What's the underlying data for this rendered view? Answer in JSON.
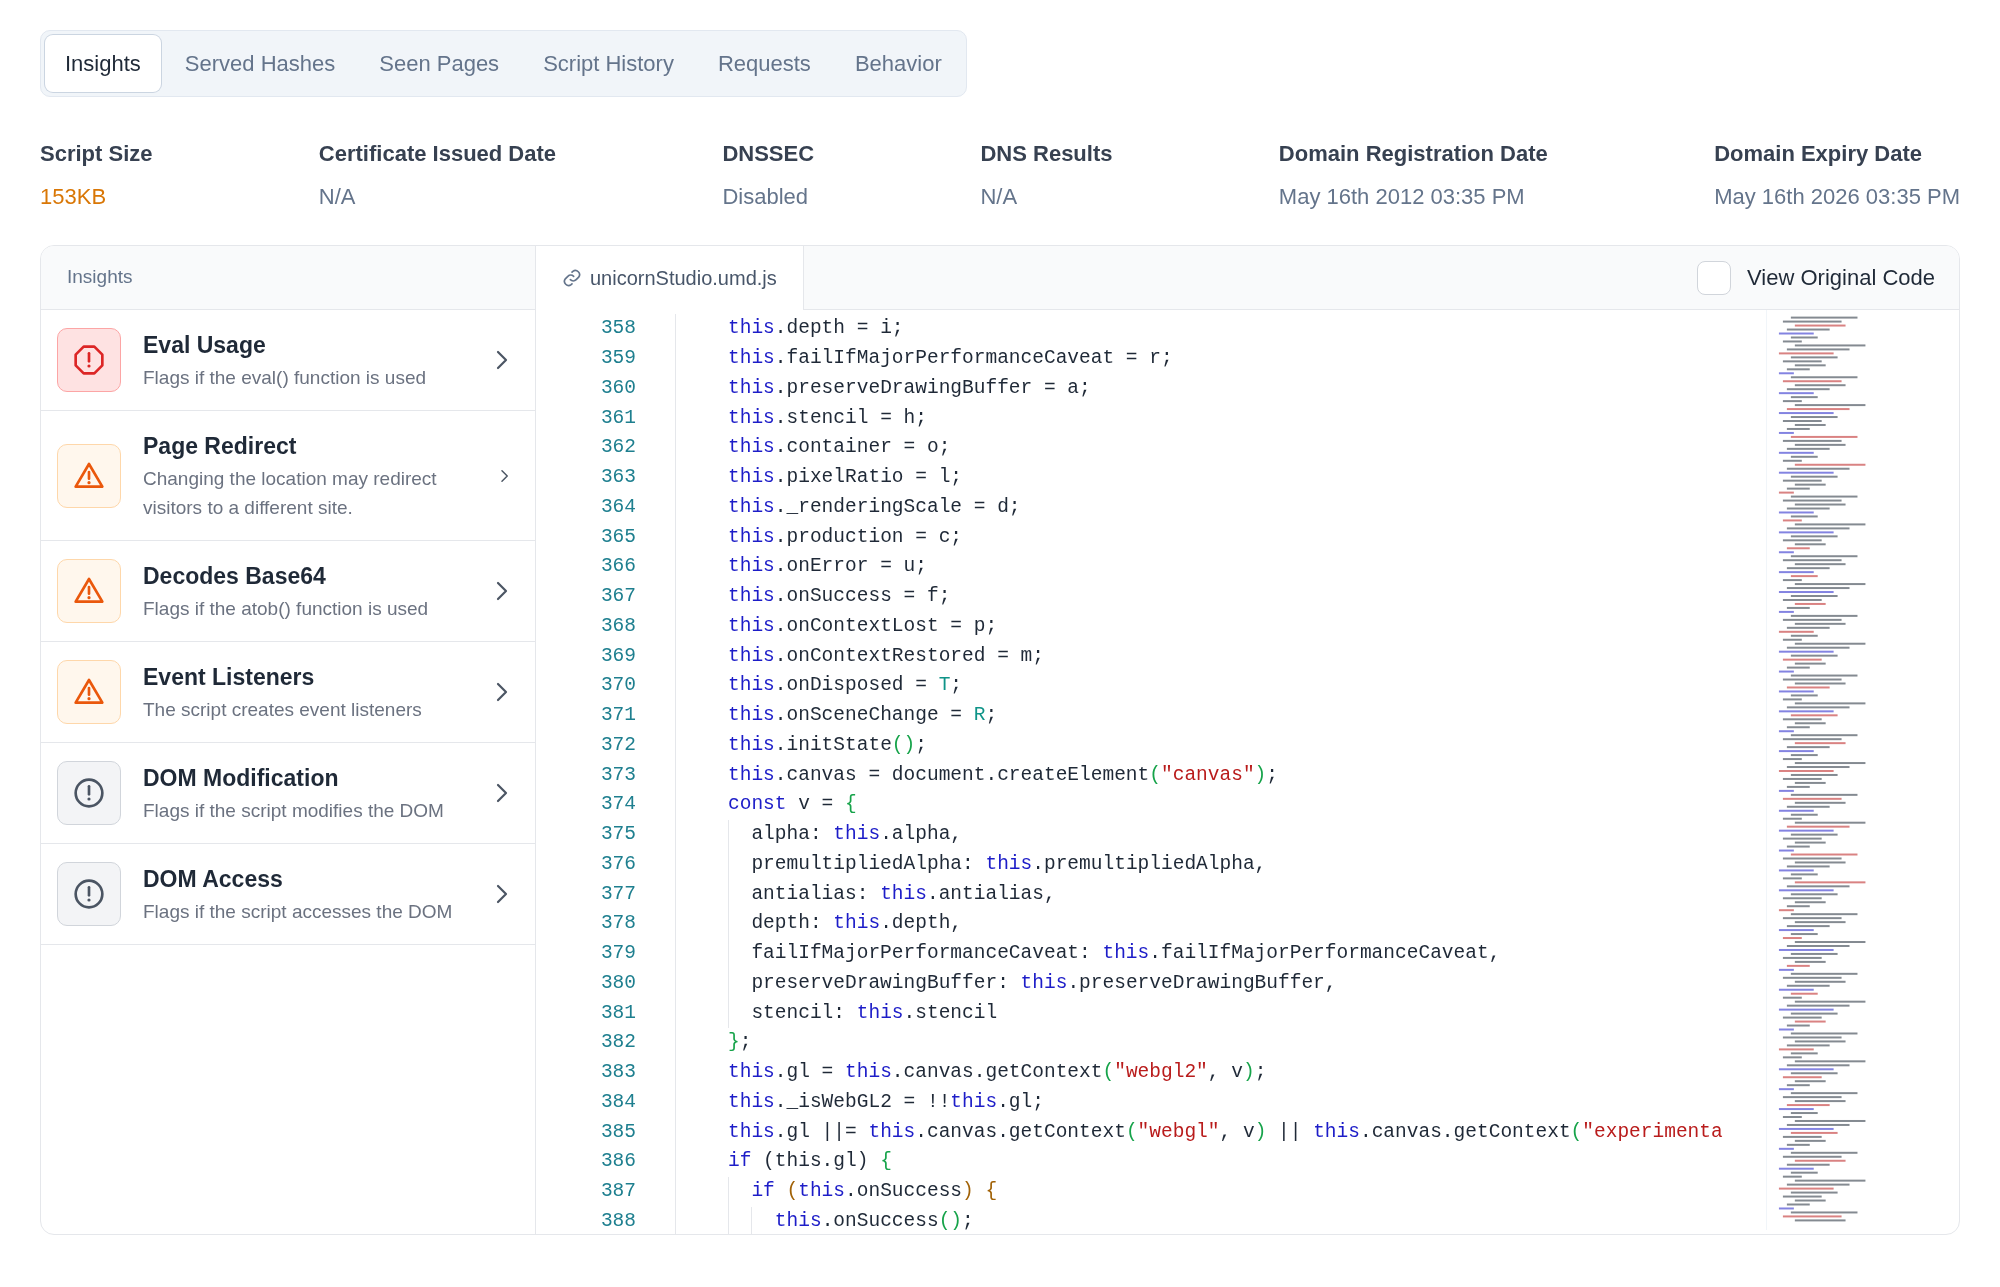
{
  "tabs": [
    {
      "label": "Insights",
      "selected": true
    },
    {
      "label": "Served Hashes",
      "selected": false
    },
    {
      "label": "Seen Pages",
      "selected": false
    },
    {
      "label": "Script History",
      "selected": false
    },
    {
      "label": "Requests",
      "selected": false
    },
    {
      "label": "Behavior",
      "selected": false
    }
  ],
  "stats": [
    {
      "label": "Script Size",
      "value": "153KB",
      "flagged": true
    },
    {
      "label": "Certificate Issued Date",
      "value": "N/A",
      "flagged": false
    },
    {
      "label": "DNSSEC",
      "value": "Disabled",
      "flagged": false
    },
    {
      "label": "DNS Results",
      "value": "N/A",
      "flagged": false
    },
    {
      "label": "Domain Registration Date",
      "value": "May 16th 2012 03:35 PM",
      "flagged": false
    },
    {
      "label": "Domain Expiry Date",
      "value": "May 16th 2026 03:35 PM",
      "flagged": false
    }
  ],
  "insights_panel": {
    "title": "Insights",
    "items": [
      {
        "title": "Eval Usage",
        "description": "Flags if the eval() function is used",
        "kind": "critical"
      },
      {
        "title": "Page Redirect",
        "description": "Changing the location may redirect visitors to a different site.",
        "kind": "warning"
      },
      {
        "title": "Decodes Base64",
        "description": "Flags if the atob() function is used",
        "kind": "warning"
      },
      {
        "title": "Event Listeners",
        "description": "The script creates event listeners",
        "kind": "warning"
      },
      {
        "title": "DOM Modification",
        "description": "Flags if the script modifies the DOM",
        "kind": "info"
      },
      {
        "title": "DOM Access",
        "description": "Flags if the script accesses the DOM",
        "kind": "info"
      }
    ]
  },
  "code_viewer": {
    "file_name": "unicornStudio.umd.js",
    "view_original": {
      "label": "View Original Code",
      "checked": false
    },
    "lines": [
      {
        "number": "358",
        "tokens": [
          {
            "kind": "kw",
            "text": "this"
          },
          {
            "kind": "plain",
            "text": ".depth = i;"
          }
        ]
      },
      {
        "number": "359",
        "tokens": [
          {
            "kind": "kw",
            "text": "this"
          },
          {
            "kind": "plain",
            "text": ".failIfMajorPerformanceCaveat = r;"
          }
        ]
      },
      {
        "number": "360",
        "tokens": [
          {
            "kind": "kw",
            "text": "this"
          },
          {
            "kind": "plain",
            "text": ".preserveDrawingBuffer = a;"
          }
        ]
      },
      {
        "number": "361",
        "tokens": [
          {
            "kind": "kw",
            "text": "this"
          },
          {
            "kind": "plain",
            "text": ".stencil = h;"
          }
        ]
      },
      {
        "number": "362",
        "tokens": [
          {
            "kind": "kw",
            "text": "this"
          },
          {
            "kind": "plain",
            "text": ".container = o;"
          }
        ]
      },
      {
        "number": "363",
        "tokens": [
          {
            "kind": "kw",
            "text": "this"
          },
          {
            "kind": "plain",
            "text": ".pixelRatio = l;"
          }
        ]
      },
      {
        "number": "364",
        "tokens": [
          {
            "kind": "kw",
            "text": "this"
          },
          {
            "kind": "plain",
            "text": "._renderingScale = d;"
          }
        ]
      },
      {
        "number": "365",
        "tokens": [
          {
            "kind": "kw",
            "text": "this"
          },
          {
            "kind": "plain",
            "text": ".production = c;"
          }
        ]
      },
      {
        "number": "366",
        "tokens": [
          {
            "kind": "kw",
            "text": "this"
          },
          {
            "kind": "plain",
            "text": ".onError = u;"
          }
        ]
      },
      {
        "number": "367",
        "tokens": [
          {
            "kind": "kw",
            "text": "this"
          },
          {
            "kind": "plain",
            "text": ".onSuccess = f;"
          }
        ]
      },
      {
        "number": "368",
        "tokens": [
          {
            "kind": "kw",
            "text": "this"
          },
          {
            "kind": "plain",
            "text": ".onContextLost = p;"
          }
        ]
      },
      {
        "number": "369",
        "tokens": [
          {
            "kind": "kw",
            "text": "this"
          },
          {
            "kind": "plain",
            "text": ".onContextRestored = m;"
          }
        ]
      },
      {
        "number": "370",
        "tokens": [
          {
            "kind": "kw",
            "text": "this"
          },
          {
            "kind": "plain",
            "text": ".onDisposed = "
          },
          {
            "kind": "const",
            "text": "T"
          },
          {
            "kind": "plain",
            "text": ";"
          }
        ]
      },
      {
        "number": "371",
        "tokens": [
          {
            "kind": "kw",
            "text": "this"
          },
          {
            "kind": "plain",
            "text": ".onSceneChange = "
          },
          {
            "kind": "const",
            "text": "R"
          },
          {
            "kind": "plain",
            "text": ";"
          }
        ]
      },
      {
        "number": "372",
        "tokens": [
          {
            "kind": "kw",
            "text": "this"
          },
          {
            "kind": "plain",
            "text": ".initState"
          },
          {
            "kind": "bracket",
            "text": "()"
          },
          {
            "kind": "plain",
            "text": ";"
          }
        ]
      },
      {
        "number": "373",
        "tokens": [
          {
            "kind": "kw",
            "text": "this"
          },
          {
            "kind": "plain",
            "text": ".canvas = document.createElement"
          },
          {
            "kind": "bracket",
            "text": "("
          },
          {
            "kind": "str",
            "text": "\"canvas\""
          },
          {
            "kind": "bracket",
            "text": ")"
          },
          {
            "kind": "plain",
            "text": ";"
          }
        ]
      },
      {
        "number": "374",
        "tokens": [
          {
            "kind": "kw",
            "text": "const"
          },
          {
            "kind": "plain",
            "text": " v = "
          },
          {
            "kind": "bracket",
            "text": "{"
          }
        ]
      },
      {
        "number": "375",
        "tokens": [
          {
            "kind": "plain",
            "text": "  alpha: "
          },
          {
            "kind": "kw",
            "text": "this"
          },
          {
            "kind": "plain",
            "text": ".alpha,"
          }
        ]
      },
      {
        "number": "376",
        "tokens": [
          {
            "kind": "plain",
            "text": "  premultipliedAlpha: "
          },
          {
            "kind": "kw",
            "text": "this"
          },
          {
            "kind": "plain",
            "text": ".premultipliedAlpha,"
          }
        ]
      },
      {
        "number": "377",
        "tokens": [
          {
            "kind": "plain",
            "text": "  antialias: "
          },
          {
            "kind": "kw",
            "text": "this"
          },
          {
            "kind": "plain",
            "text": ".antialias,"
          }
        ]
      },
      {
        "number": "378",
        "tokens": [
          {
            "kind": "plain",
            "text": "  depth: "
          },
          {
            "kind": "kw",
            "text": "this"
          },
          {
            "kind": "plain",
            "text": ".depth,"
          }
        ]
      },
      {
        "number": "379",
        "tokens": [
          {
            "kind": "plain",
            "text": "  failIfMajorPerformanceCaveat: "
          },
          {
            "kind": "kw",
            "text": "this"
          },
          {
            "kind": "plain",
            "text": ".failIfMajorPerformanceCaveat,"
          }
        ]
      },
      {
        "number": "380",
        "tokens": [
          {
            "kind": "plain",
            "text": "  preserveDrawingBuffer: "
          },
          {
            "kind": "kw",
            "text": "this"
          },
          {
            "kind": "plain",
            "text": ".preserveDrawingBuffer,"
          }
        ]
      },
      {
        "number": "381",
        "tokens": [
          {
            "kind": "plain",
            "text": "  stencil: "
          },
          {
            "kind": "kw",
            "text": "this"
          },
          {
            "kind": "plain",
            "text": ".stencil"
          }
        ]
      },
      {
        "number": "382",
        "tokens": [
          {
            "kind": "bracket",
            "text": "}"
          },
          {
            "kind": "plain",
            "text": ";"
          }
        ]
      },
      {
        "number": "383",
        "tokens": [
          {
            "kind": "kw",
            "text": "this"
          },
          {
            "kind": "plain",
            "text": ".gl = "
          },
          {
            "kind": "kw",
            "text": "this"
          },
          {
            "kind": "plain",
            "text": ".canvas.getContext"
          },
          {
            "kind": "bracket",
            "text": "("
          },
          {
            "kind": "str",
            "text": "\"webgl2\""
          },
          {
            "kind": "plain",
            "text": ", v"
          },
          {
            "kind": "bracket",
            "text": ")"
          },
          {
            "kind": "plain",
            "text": ";"
          }
        ]
      },
      {
        "number": "384",
        "tokens": [
          {
            "kind": "kw",
            "text": "this"
          },
          {
            "kind": "plain",
            "text": "._isWebGL2 = !!"
          },
          {
            "kind": "kw",
            "text": "this"
          },
          {
            "kind": "plain",
            "text": ".gl;"
          }
        ]
      },
      {
        "number": "385",
        "tokens": [
          {
            "kind": "kw",
            "text": "this"
          },
          {
            "kind": "plain",
            "text": ".gl ||= "
          },
          {
            "kind": "kw",
            "text": "this"
          },
          {
            "kind": "plain",
            "text": ".canvas.getContext"
          },
          {
            "kind": "bracket",
            "text": "("
          },
          {
            "kind": "str",
            "text": "\"webgl\""
          },
          {
            "kind": "plain",
            "text": ", v"
          },
          {
            "kind": "bracket",
            "text": ")"
          },
          {
            "kind": "plain",
            "text": " || "
          },
          {
            "kind": "kw",
            "text": "this"
          },
          {
            "kind": "plain",
            "text": ".canvas.getContext"
          },
          {
            "kind": "bracket",
            "text": "("
          },
          {
            "kind": "str",
            "text": "\"experimenta"
          }
        ]
      },
      {
        "number": "386",
        "tokens": [
          {
            "kind": "kw",
            "text": "if"
          },
          {
            "kind": "plain",
            "text": " (this.gl) "
          },
          {
            "kind": "bracket",
            "text": "{"
          }
        ]
      },
      {
        "number": "387",
        "tokens": [
          {
            "kind": "kw",
            "text": "  if"
          },
          {
            "kind": "bracket2",
            "text": " ("
          },
          {
            "kind": "kw",
            "text": "this"
          },
          {
            "kind": "plain",
            "text": ".onSuccess"
          },
          {
            "kind": "bracket2",
            "text": ") {"
          }
        ]
      },
      {
        "number": "388",
        "tokens": [
          {
            "kind": "kw",
            "text": "    this"
          },
          {
            "kind": "plain",
            "text": ".onSuccess"
          },
          {
            "kind": "bracket",
            "text": "()"
          },
          {
            "kind": "plain",
            "text": ";"
          }
        ]
      }
    ]
  }
}
